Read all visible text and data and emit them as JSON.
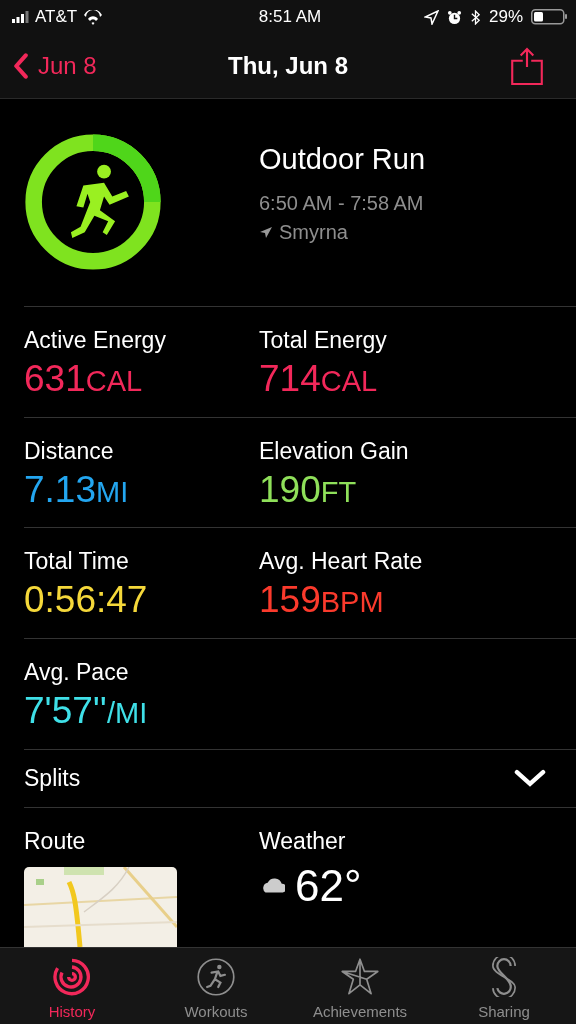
{
  "status_bar": {
    "carrier": "AT&T",
    "time": "8:51 AM",
    "battery": "29%"
  },
  "nav": {
    "back": "Jun 8",
    "title": "Thu, Jun 8"
  },
  "workout": {
    "name": "Outdoor Run",
    "time_range": "6:50 AM - 7:58 AM",
    "location": "Smyrna"
  },
  "metric_rows": [
    [
      {
        "label": "Active Energy",
        "value": "631",
        "unit": "CAL",
        "color": "#f2285a"
      },
      {
        "label": "Total Energy",
        "value": "714",
        "unit": "CAL",
        "color": "#f2285a"
      }
    ],
    [
      {
        "label": "Distance",
        "value": "7.13",
        "unit": "MI",
        "color": "#23a6f0"
      },
      {
        "label": "Elevation Gain",
        "value": "190",
        "unit": "FT",
        "color": "#8fe05a"
      }
    ],
    [
      {
        "label": "Total Time",
        "value": "0:56:47",
        "color": "#f5d83a"
      },
      {
        "label": "Avg. Heart Rate",
        "value": "159",
        "unit": "BPM",
        "color": "#fb3a2c"
      }
    ],
    [
      {
        "label": "Avg. Pace",
        "value": "7'57''",
        "unit": "/MI",
        "color": "#3fe0e8"
      }
    ]
  ],
  "splits": {
    "label": "Splits",
    "expanded": false
  },
  "route": {
    "label": "Route"
  },
  "weather": {
    "label": "Weather",
    "temperature": "62°"
  },
  "tab_bar": [
    {
      "label": "History",
      "selected": true,
      "kind": "history"
    },
    {
      "label": "Workouts",
      "selected": false,
      "kind": "workouts"
    },
    {
      "label": "Achievements",
      "selected": false,
      "kind": "achievements"
    },
    {
      "label": "Sharing",
      "selected": false,
      "kind": "sharing"
    }
  ]
}
